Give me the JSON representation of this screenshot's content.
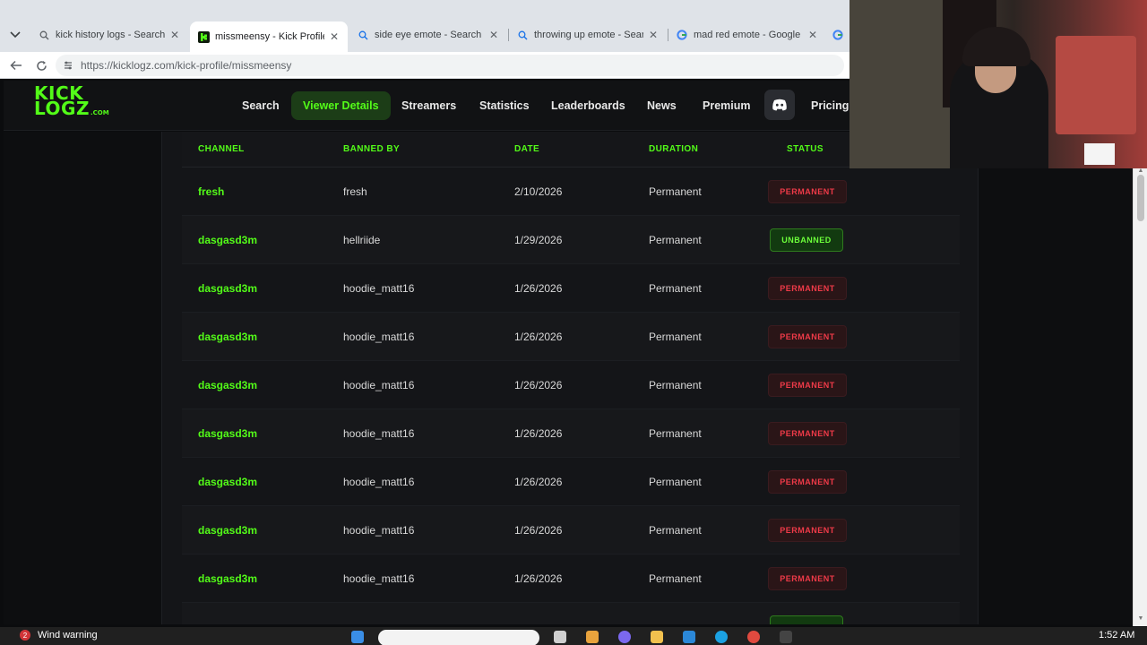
{
  "browser": {
    "tabs": [
      {
        "title": "kick history logs - Search",
        "favicon": "search-icon",
        "active": false
      },
      {
        "title": "missmeensy - Kick Profile",
        "favicon": "kick-icon",
        "active": true
      },
      {
        "title": "side eye emote - Search Imag",
        "favicon": "search-icon",
        "active": false
      },
      {
        "title": "throwing up emote - Search I",
        "favicon": "search-icon",
        "active": false
      },
      {
        "title": "mad red emote - Google Sea",
        "favicon": "google-icon",
        "active": false
      }
    ],
    "url": "https://kicklogz.com/kick-profile/missmeensy"
  },
  "site": {
    "logo_line1": "KICK",
    "logo_line2": "LOGZ",
    "logo_domain": ".COM",
    "nav": [
      {
        "label": "Search"
      },
      {
        "label": "Viewer Details",
        "active": true
      },
      {
        "label": "Streamers"
      },
      {
        "label": "Statistics"
      },
      {
        "label": "Leaderboards"
      },
      {
        "label": "News"
      },
      {
        "label": "Premium"
      },
      {
        "label": "Pricing"
      }
    ],
    "colors": {
      "accent": "#53fc18",
      "danger": "#ef3a48",
      "background": "#0d0e10"
    }
  },
  "table": {
    "headers": {
      "channel": "CHANNEL",
      "banned_by": "BANNED BY",
      "date": "DATE",
      "duration": "DURATION",
      "status": "STATUS"
    },
    "rows": [
      {
        "channel": "fresh",
        "banned_by": "fresh",
        "date": "2/10/2026",
        "duration": "Permanent",
        "status": "PERMANENT",
        "status_type": "perm"
      },
      {
        "channel": "dasgasd3m",
        "banned_by": "hellriide",
        "date": "1/29/2026",
        "duration": "Permanent",
        "status": "UNBANNED",
        "status_type": "unban"
      },
      {
        "channel": "dasgasd3m",
        "banned_by": "hoodie_matt16",
        "date": "1/26/2026",
        "duration": "Permanent",
        "status": "PERMANENT",
        "status_type": "perm"
      },
      {
        "channel": "dasgasd3m",
        "banned_by": "hoodie_matt16",
        "date": "1/26/2026",
        "duration": "Permanent",
        "status": "PERMANENT",
        "status_type": "perm"
      },
      {
        "channel": "dasgasd3m",
        "banned_by": "hoodie_matt16",
        "date": "1/26/2026",
        "duration": "Permanent",
        "status": "PERMANENT",
        "status_type": "perm"
      },
      {
        "channel": "dasgasd3m",
        "banned_by": "hoodie_matt16",
        "date": "1/26/2026",
        "duration": "Permanent",
        "status": "PERMANENT",
        "status_type": "perm"
      },
      {
        "channel": "dasgasd3m",
        "banned_by": "hoodie_matt16",
        "date": "1/26/2026",
        "duration": "Permanent",
        "status": "PERMANENT",
        "status_type": "perm"
      },
      {
        "channel": "dasgasd3m",
        "banned_by": "hoodie_matt16",
        "date": "1/26/2026",
        "duration": "Permanent",
        "status": "PERMANENT",
        "status_type": "perm"
      },
      {
        "channel": "dasgasd3m",
        "banned_by": "hoodie_matt16",
        "date": "1/26/2026",
        "duration": "Permanent",
        "status": "PERMANENT",
        "status_type": "perm"
      }
    ]
  },
  "taskbar": {
    "weather_badge": "2",
    "weather_text": "Wind warning",
    "clock": "1:52 AM"
  }
}
